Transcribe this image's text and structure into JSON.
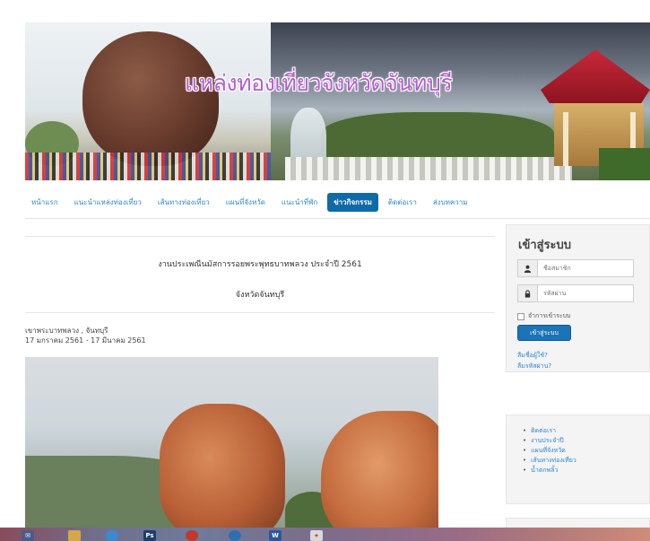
{
  "banner": {
    "title": "แหล่งท่องเที่ยวจังหวัดจันทบุรี"
  },
  "nav": {
    "items": [
      {
        "label": "หน้าแรก",
        "active": false
      },
      {
        "label": "แนะนำแหล่งท่องเที่ยว",
        "active": false
      },
      {
        "label": "เส้นทางท่องเที่ยว",
        "active": false
      },
      {
        "label": "แผนที่จังหวัด",
        "active": false
      },
      {
        "label": "แนะนำที่พัก",
        "active": false
      },
      {
        "label": "ข่าวกิจกรรม",
        "active": true
      },
      {
        "label": "ติดต่อเรา",
        "active": false
      },
      {
        "label": "ส่งบทความ",
        "active": false
      }
    ]
  },
  "article": {
    "title": "งานประเพณีนมัสการรอยพระพุทธบาทพลวง ประจำปี 2561",
    "subtitle": "จังหวัดจันทบุรี",
    "location": "เขาพระบาทพลวง , จันทบุรี",
    "date_range": "17 มกราคม 2561 - 17 มีนาคม 2561"
  },
  "login": {
    "heading": "เข้าสู่ระบบ",
    "username_placeholder": "ชื่อสมาชิก",
    "password_placeholder": "รหัสผ่าน",
    "remember_label": "จำการเข้าระบบ",
    "submit_label": "เข้าสู่ระบบ",
    "forgot_username": "ลืมชื่อผู้ใช้?",
    "forgot_password": "ลืมรหัสผ่าน?"
  },
  "side_menu": {
    "items": [
      {
        "label": "ติดต่อเรา"
      },
      {
        "label": "งานประจำปี"
      },
      {
        "label": "แผนที่จังหวัด"
      },
      {
        "label": "เส้นทางท่องเที่ยว"
      },
      {
        "label": "น้ำตกพลิ้ว"
      }
    ]
  },
  "taskbar": {
    "apps": [
      {
        "icon": "mail-icon",
        "label": ""
      },
      {
        "icon": "explorer-icon",
        "label": ""
      },
      {
        "icon": "chrome-icon",
        "label": ""
      },
      {
        "icon": "photoshop-icon",
        "label": "Ps"
      },
      {
        "icon": "media-icon",
        "label": ""
      },
      {
        "icon": "firefox-icon",
        "label": ""
      },
      {
        "icon": "word-icon",
        "label": "W"
      },
      {
        "icon": "pdf-icon",
        "label": ""
      }
    ]
  }
}
